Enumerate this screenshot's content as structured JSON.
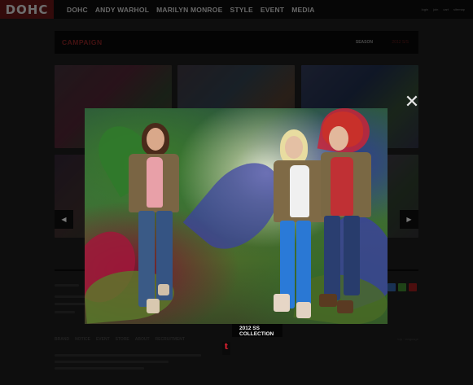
{
  "logo": {
    "text": "DOHC"
  },
  "nav": {
    "items": [
      "DOHC",
      "ANDY WARHOL",
      "MARILYN MONROE",
      "STYLE",
      "EVENT",
      "MEDIA"
    ]
  },
  "utility_links": [
    "login",
    "join",
    "cart",
    "sitemap"
  ],
  "campaign": {
    "title": "CAMPAIGN",
    "season_label": "SEASON",
    "season_value": "2012 S/S"
  },
  "lightbox": {
    "close_symbol": "✕",
    "badge_line1": "2012 SS",
    "badge_line2": "COLLECTION",
    "tumblr_symbol": "t"
  },
  "carousel": {
    "prev_symbol": "◀",
    "next_symbol": "▶"
  },
  "footer": {
    "links": [
      "BRAND",
      "NOTICE",
      "EVENT",
      "STORE",
      "ABOUT",
      "RECRUITMENT"
    ],
    "right_text": "top  ·  language"
  },
  "colors": {
    "logo_bg": "#5e1515",
    "campaign_title": "#7a2020",
    "share": [
      "#2e5a9a",
      "#3a7a2a",
      "#8a1a1a"
    ]
  }
}
